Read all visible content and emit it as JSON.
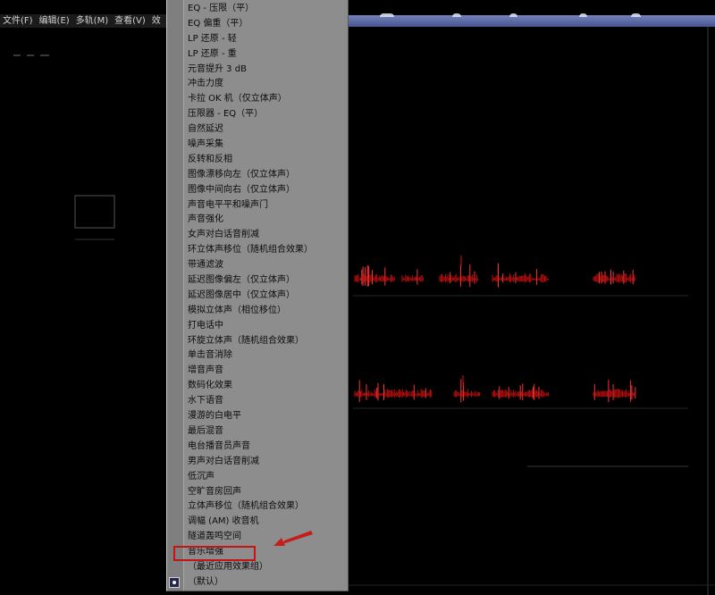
{
  "menubar": {
    "items": [
      {
        "label": "文件(F)"
      },
      {
        "label": "编辑(E)"
      },
      {
        "label": "多轨(M)"
      },
      {
        "label": "查看(V)"
      },
      {
        "label": "效"
      }
    ]
  },
  "preset_menu": {
    "items": [
      {
        "label": "EQ - 压限（平）"
      },
      {
        "label": "EQ 偏重（平）"
      },
      {
        "label": "LP 还原 - 轻"
      },
      {
        "label": "LP 还原 - 重"
      },
      {
        "label": "元音提升 3 dB"
      },
      {
        "label": "冲击力度"
      },
      {
        "label": "卡拉 OK 机（仅立体声）"
      },
      {
        "label": "压限器 - EQ（平）"
      },
      {
        "label": "自然延迟"
      },
      {
        "label": "噪声采集"
      },
      {
        "label": "反转和反相"
      },
      {
        "label": "图像漂移向左（仅立体声）"
      },
      {
        "label": "图像中间向右（仅立体声）"
      },
      {
        "label": "声音电平平和噪声门"
      },
      {
        "label": "声音强化"
      },
      {
        "label": "女声对白话音削减"
      },
      {
        "label": "环立体声移位（随机组合效果）"
      },
      {
        "label": "带通滤波"
      },
      {
        "label": "延迟图像偏左（仅立体声）"
      },
      {
        "label": "延迟图像居中（仅立体声）"
      },
      {
        "label": "模拟立体声（相位移位）"
      },
      {
        "label": "打电话中"
      },
      {
        "label": "环旋立体声（随机组合效果）"
      },
      {
        "label": "单击音消除"
      },
      {
        "label": "增音声音"
      },
      {
        "label": "数码化效果"
      },
      {
        "label": "水下语音"
      },
      {
        "label": "漫游的白电平"
      },
      {
        "label": "最后混音"
      },
      {
        "label": "电台播音员声音"
      },
      {
        "label": "男声对白话音削减"
      },
      {
        "label": "低沉声"
      },
      {
        "label": "空旷音房回声"
      },
      {
        "label": "立体声移位（随机组合效果）"
      },
      {
        "label": "调幅 (AM) 收音机"
      },
      {
        "label": "隧道轰鸣空间"
      },
      {
        "label": "音乐增强",
        "annotated": true
      },
      {
        "label": "（最近应用效果组）"
      },
      {
        "label": "（默认）",
        "checked": true
      }
    ]
  },
  "colors": {
    "menu_background": "#8d8d8d",
    "annotation_red": "#c41414",
    "waveform_red": "#b80d0d",
    "waveform_peak": "#ff3030"
  },
  "icons": {
    "checked_marker": "selected-radio-icon",
    "annotation_arrow": "red-arrow-icon"
  }
}
